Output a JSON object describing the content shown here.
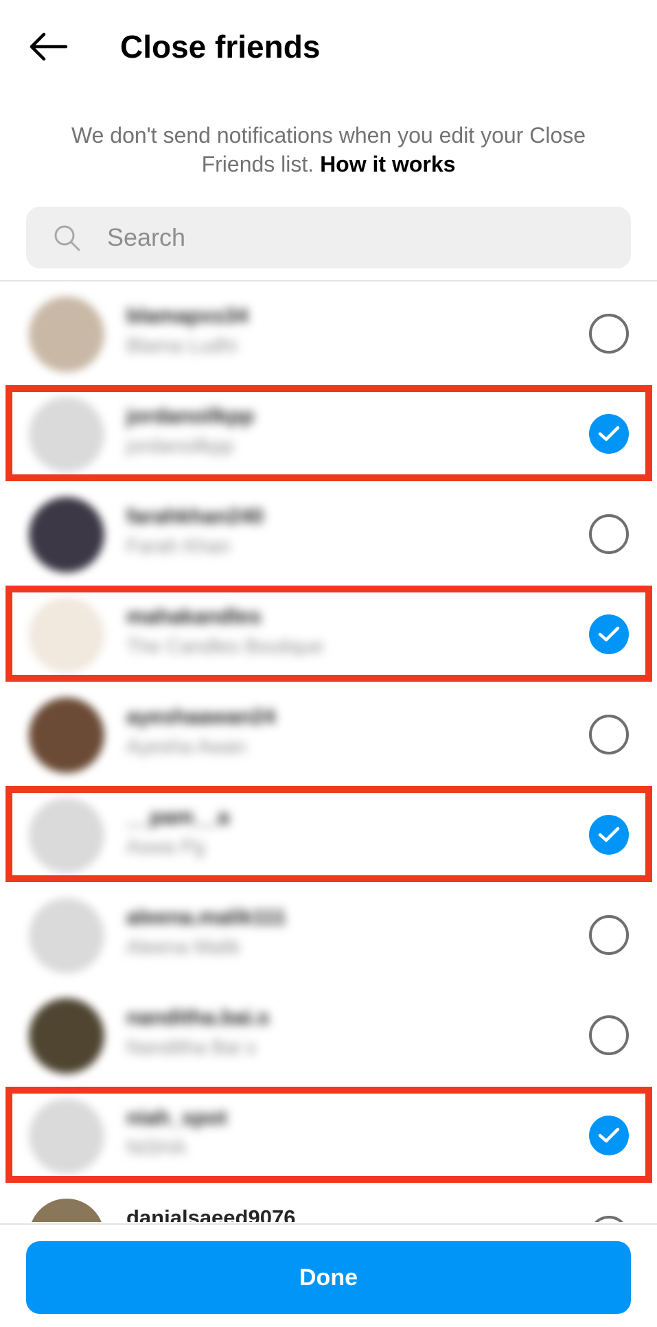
{
  "header": {
    "title": "Close friends",
    "back_icon": "arrow-left-icon"
  },
  "info": {
    "text": "We don't send notifications when you edit your Close Friends list.",
    "link": "How it works"
  },
  "search": {
    "placeholder": "Search",
    "value": "",
    "icon": "search-icon"
  },
  "colors": {
    "accent": "#0095f6",
    "highlight": "#f0381e",
    "unchecked": "#6f6f6f",
    "muted_text": "#737373"
  },
  "friends": [
    {
      "username": "blamapxs34",
      "fullname": "Blama Ludhi",
      "selected": false,
      "avatar_color": "#c9b8a6"
    },
    {
      "username": "jordanoilkpp",
      "fullname": "jordanoilkpp",
      "selected": true,
      "avatar_color": "#dadada"
    },
    {
      "username": "farahkhan240",
      "fullname": "Farah Khan",
      "selected": false,
      "avatar_color": "#3c3846"
    },
    {
      "username": "mahakandles",
      "fullname": "The Candles Boutique",
      "selected": true,
      "avatar_color": "#f1e8de"
    },
    {
      "username": "ayeshaawan24",
      "fullname": "Ayesha Awan",
      "selected": false,
      "avatar_color": "#6b4b36"
    },
    {
      "username": "__pam__a",
      "fullname": "Aswa Pg",
      "selected": true,
      "avatar_color": "#dadada"
    },
    {
      "username": "aleena.malik111",
      "fullname": "Aleena Malik",
      "selected": false,
      "avatar_color": "#dadada"
    },
    {
      "username": "nanditha.bai.s",
      "fullname": "Nanditha Bai s",
      "selected": false,
      "avatar_color": "#4f4531"
    },
    {
      "username": "niah_spot",
      "fullname": "NiSHA",
      "selected": true,
      "avatar_color": "#dadada"
    },
    {
      "username": "danialsaeed9076",
      "fullname": "",
      "selected": false,
      "avatar_color": "#8a7658"
    }
  ],
  "done": {
    "label": "Done"
  }
}
